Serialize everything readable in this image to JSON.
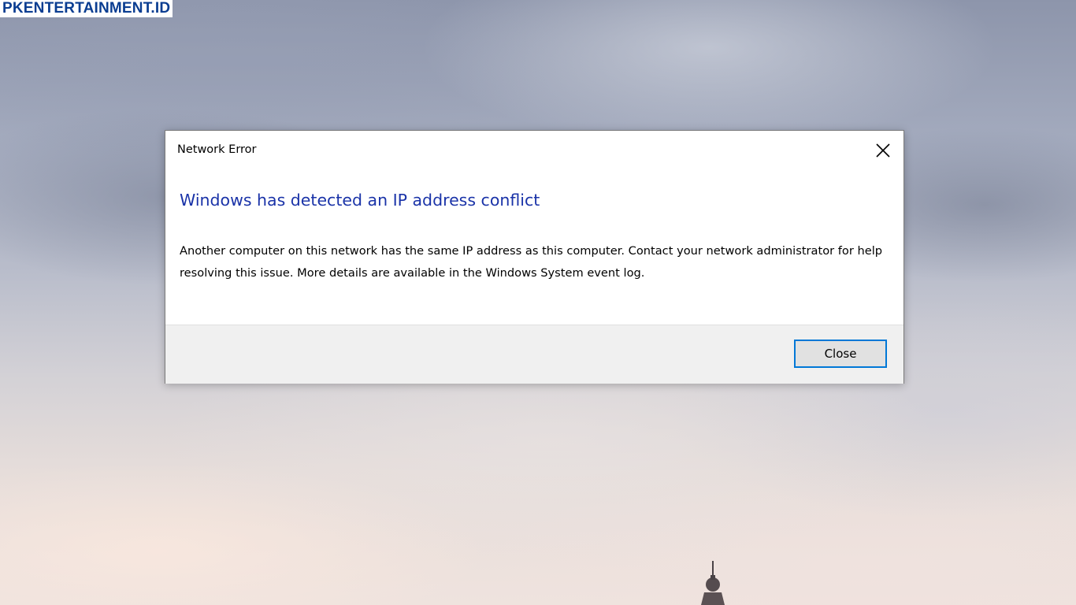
{
  "watermark": {
    "text": "PKENTERTAINMENT.ID"
  },
  "dialog": {
    "title": "Network Error",
    "close_icon": "close-icon",
    "heading": "Windows has detected an IP address conflict",
    "message": "Another computer on this network has the same IP address as this computer. Contact your network administrator for help resolving this issue. More details are available in the Windows System event log.",
    "close_button_label": "Close"
  },
  "colors": {
    "heading": "#1a33a8",
    "button_focus_border": "#0078d7",
    "footer_background": "#f0f0f0",
    "watermark_text": "#0a3d91"
  }
}
